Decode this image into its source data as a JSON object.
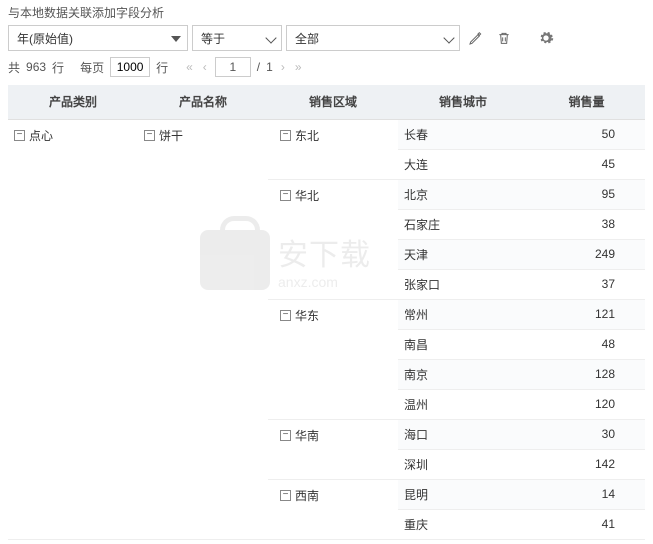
{
  "title": "与本地数据关联添加字段分析",
  "filters": {
    "field_label": "年(原始值)",
    "operator_label": "等于",
    "value_label": "全部"
  },
  "pager": {
    "pre_rows": "共",
    "total_rows": "963",
    "rows_suffix": "行",
    "per_page_label": "每页",
    "per_page_value": "1000",
    "rows_suffix2": "行",
    "current_page": "1",
    "total_pages": "1",
    "separator": "/"
  },
  "columns": {
    "category": "产品类别",
    "product": "产品名称",
    "region": "销售区域",
    "city": "销售城市",
    "qty": "销售量"
  },
  "rows": {
    "category": "点心",
    "product": "饼干",
    "regions": [
      {
        "name": "东北",
        "cities": [
          {
            "name": "长春",
            "qty": "50"
          },
          {
            "name": "大连",
            "qty": "45"
          }
        ]
      },
      {
        "name": "华北",
        "cities": [
          {
            "name": "北京",
            "qty": "95"
          },
          {
            "name": "石家庄",
            "qty": "38"
          },
          {
            "name": "天津",
            "qty": "249"
          },
          {
            "name": "张家口",
            "qty": "37"
          }
        ]
      },
      {
        "name": "华东",
        "cities": [
          {
            "name": "常州",
            "qty": "121"
          },
          {
            "name": "南昌",
            "qty": "48"
          },
          {
            "name": "南京",
            "qty": "128"
          },
          {
            "name": "温州",
            "qty": "120"
          }
        ]
      },
      {
        "name": "华南",
        "cities": [
          {
            "name": "海口",
            "qty": "30"
          },
          {
            "name": "深圳",
            "qty": "142"
          }
        ]
      },
      {
        "name": "西南",
        "cities": [
          {
            "name": "昆明",
            "qty": "14"
          },
          {
            "name": "重庆",
            "qty": "41"
          }
        ]
      }
    ]
  },
  "watermark": {
    "main": "安下载",
    "sub": "anxz.com"
  }
}
